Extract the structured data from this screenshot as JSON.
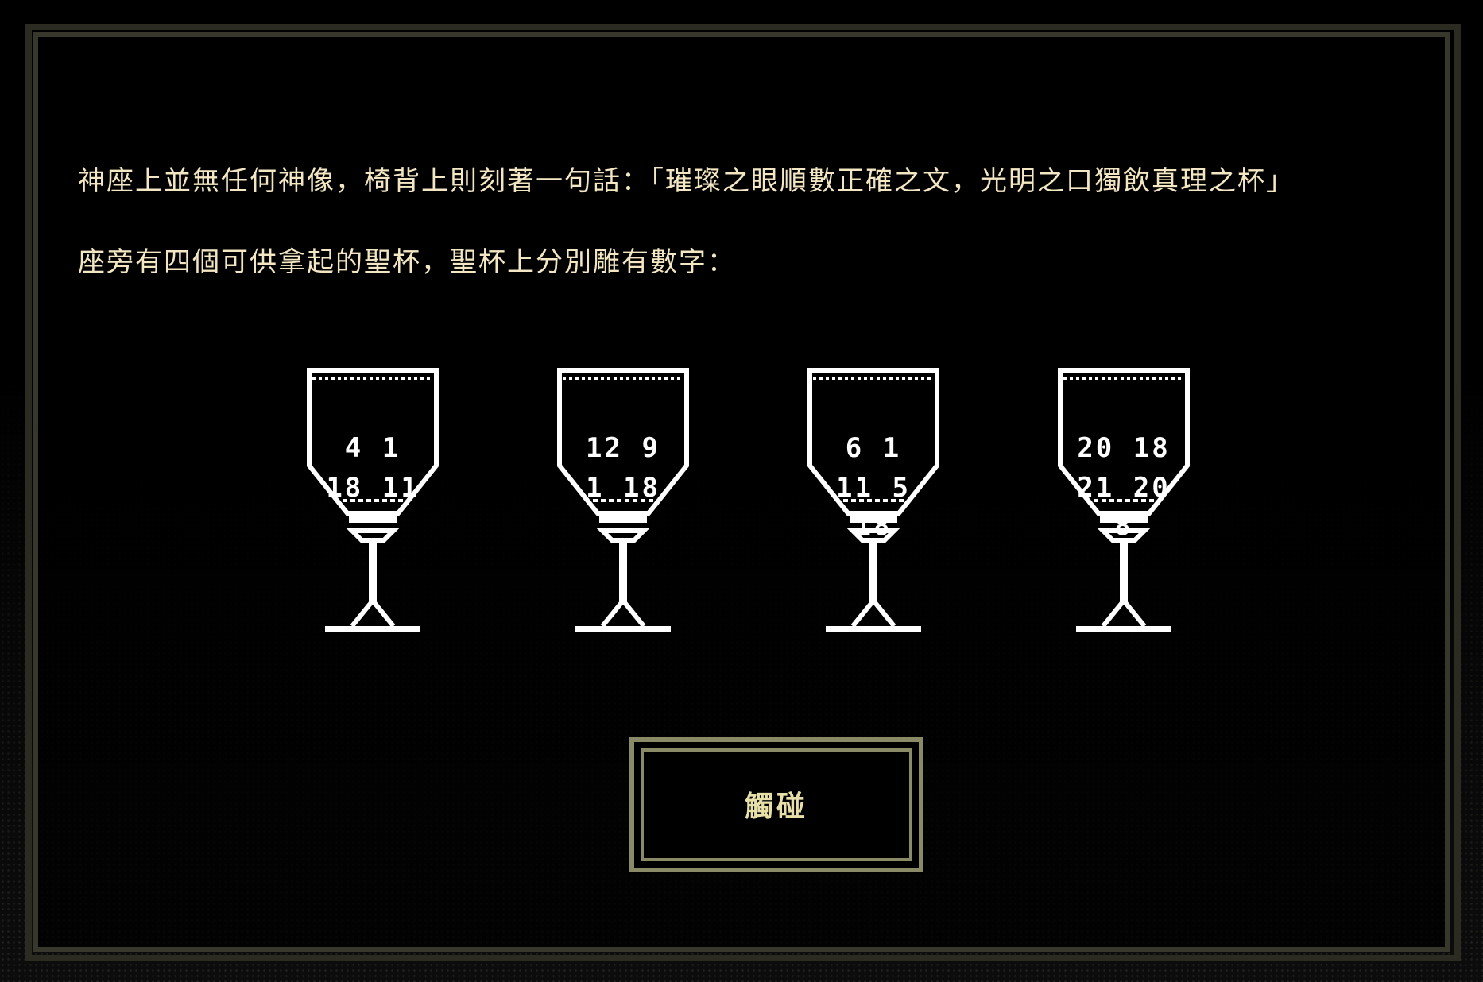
{
  "dialog": {
    "line1": "神座上並無任何神像，椅背上則刻著一句話：「璀璨之眼順數正確之文，光明之口獨飲真理之杯」",
    "line2": "座旁有四個可供拿起的聖杯，聖杯上分別雕有數字："
  },
  "goblets": [
    {
      "rows": [
        "4 1",
        "18 11",
        ""
      ]
    },
    {
      "rows": [
        "12 9",
        "1 18",
        ""
      ]
    },
    {
      "rows": [
        "6 1",
        "11 5",
        "18"
      ]
    },
    {
      "rows": [
        "20 18",
        "21 20",
        "8"
      ]
    }
  ],
  "button": {
    "label": "觸碰"
  },
  "colors": {
    "text": "#f3e6c3",
    "button_border": "#8a8a66",
    "button_text": "#e6e0a8",
    "frame": "#38372b"
  }
}
